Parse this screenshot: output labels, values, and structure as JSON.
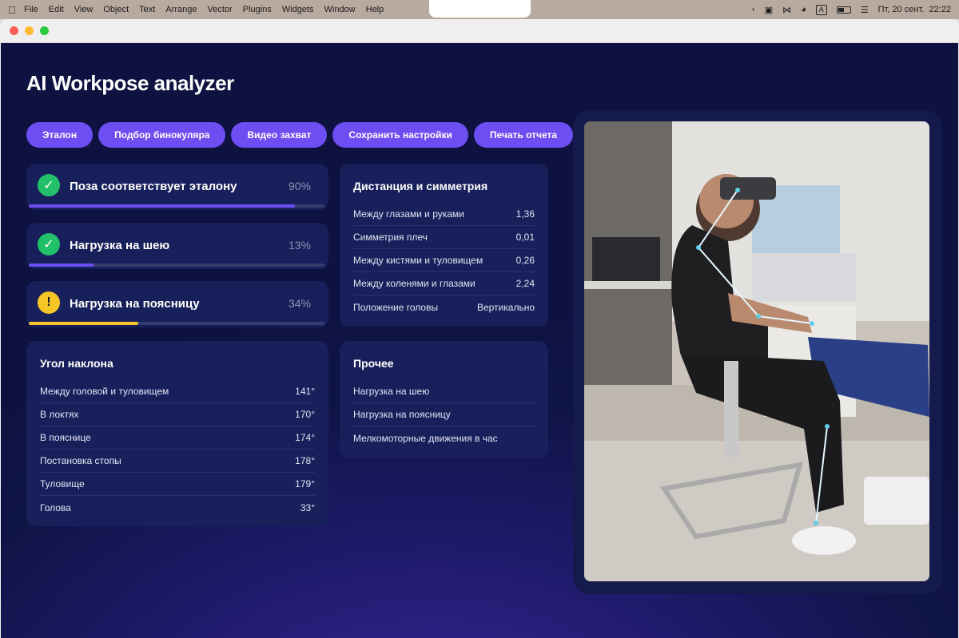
{
  "menubar": {
    "app_menus": [
      "File",
      "Edit",
      "View",
      "Object",
      "Text",
      "Arrange",
      "Vector",
      "Plugins",
      "Widgets",
      "Window",
      "Help"
    ],
    "input_source": "A",
    "datetime": "Пт, 20 сент.  22:22"
  },
  "app": {
    "title": "AI Workpose analyzer",
    "buttons": [
      "Эталон",
      "Подбор бинокуляра",
      "Видео захват",
      "Сохранить настройки",
      "Печать отчета"
    ]
  },
  "pose_cards": [
    {
      "label": "Поза соответствует эталону",
      "percent_text": "90%",
      "fill": 0.9,
      "status": "ok",
      "icon": "check-icon",
      "color": "#6c4ef2"
    },
    {
      "label": "Нагрузка на шею",
      "percent_text": "13%",
      "fill": 0.22,
      "status": "ok",
      "icon": "check-icon",
      "color": "#6c4ef2"
    },
    {
      "label": "Нагрузка на поясницу",
      "percent_text": "34%",
      "fill": 0.37,
      "status": "warning",
      "icon": "exclamation-icon",
      "color": "#f5c625"
    }
  ],
  "tilt_angle": {
    "title": "Угол наклона",
    "rows": [
      {
        "label": "Между головой и туловищем",
        "value": "141°"
      },
      {
        "label": "В локтях",
        "value": "170°"
      },
      {
        "label": "В пояснице",
        "value": "174°"
      },
      {
        "label": "Постановка стопы",
        "value": "178°"
      },
      {
        "label": "Туловище",
        "value": "179°"
      },
      {
        "label": "Голова",
        "value": "33°"
      }
    ]
  },
  "distance_symmetry": {
    "title": "Дистанция и симметрия",
    "rows": [
      {
        "label": "Между глазами и руками",
        "value": "1,36"
      },
      {
        "label": "Симметрия плеч",
        "value": "0,01"
      },
      {
        "label": "Между кистями и туловищем",
        "value": "0,26"
      },
      {
        "label": "Между коленями и глазами",
        "value": "2,24"
      },
      {
        "label": "Положение головы",
        "value": "Вертикально"
      }
    ]
  },
  "other": {
    "title": "Прочее",
    "rows": [
      {
        "label": "Нагрузка на шею",
        "value": ""
      },
      {
        "label": "Нагрузка на поясницу",
        "value": ""
      },
      {
        "label": "Мелкомоторные движения в час",
        "value": ""
      }
    ]
  },
  "photo": {
    "icon": "pose-photo-image",
    "skeleton_color": "#5fd0e8"
  }
}
